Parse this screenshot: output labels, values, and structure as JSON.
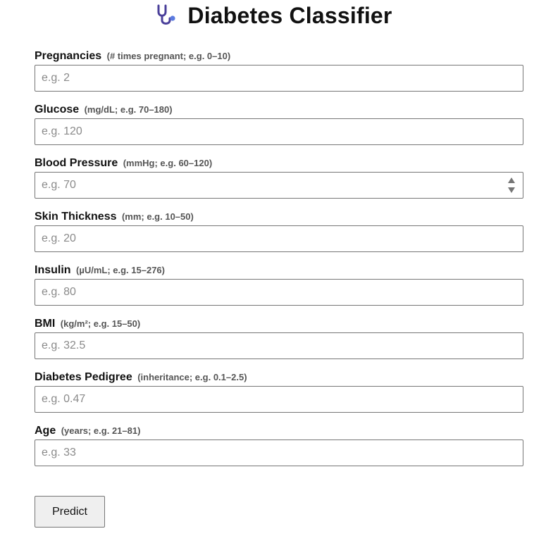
{
  "header": {
    "icon": "stethoscope-icon",
    "title": "Diabetes Classifier",
    "icon_color": "#4a3f9a",
    "icon_accent": "#5b7be0"
  },
  "fields": [
    {
      "label": "Pregnancies",
      "hint": "(# times pregnant; e.g. 0–10)",
      "placeholder": "e.g. 2",
      "value": ""
    },
    {
      "label": "Glucose",
      "hint": "(mg/dL; e.g. 70–180)",
      "placeholder": "e.g. 120",
      "value": ""
    },
    {
      "label": "Blood Pressure",
      "hint": "(mmHg; e.g. 60–120)",
      "placeholder": "e.g. 70",
      "value": "",
      "has_spinner": true
    },
    {
      "label": "Skin Thickness",
      "hint": "(mm; e.g. 10–50)",
      "placeholder": "e.g. 20",
      "value": ""
    },
    {
      "label": "Insulin",
      "hint": "(µU/mL; e.g. 15–276)",
      "placeholder": "e.g. 80",
      "value": ""
    },
    {
      "label": "BMI",
      "hint": "(kg/m²; e.g. 15–50)",
      "placeholder": "e.g. 32.5",
      "value": ""
    },
    {
      "label": "Diabetes Pedigree",
      "hint": "(inheritance; e.g. 0.1–2.5)",
      "placeholder": "e.g. 0.47",
      "value": ""
    },
    {
      "label": "Age",
      "hint": "(years; e.g. 21–81)",
      "placeholder": "e.g. 33",
      "value": ""
    }
  ],
  "predict_button": {
    "label": "Predict"
  }
}
